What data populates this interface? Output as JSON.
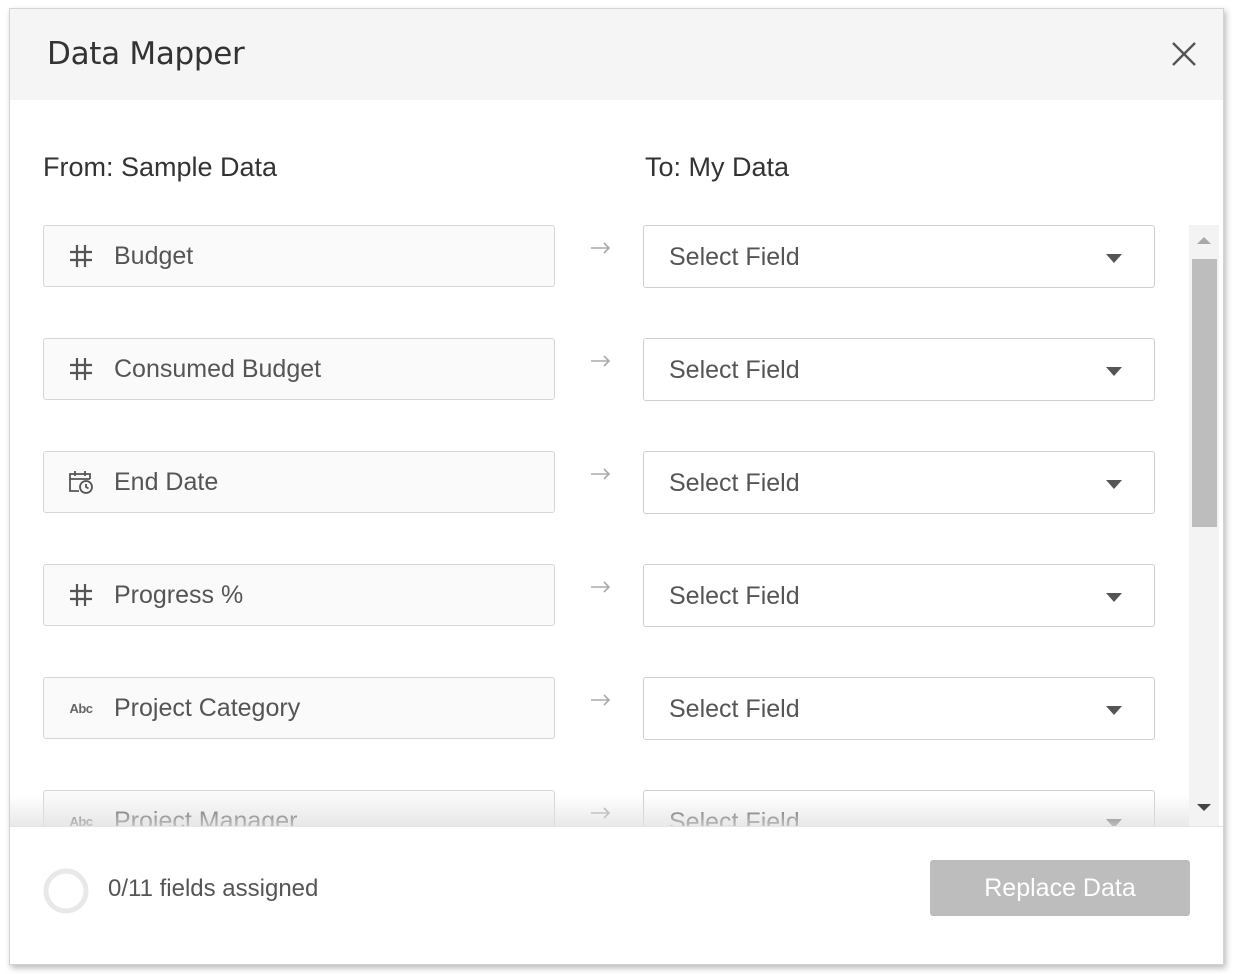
{
  "dialog": {
    "title": "Data Mapper",
    "close_icon": "close-icon"
  },
  "columns": {
    "from_label": "From: Sample Data",
    "to_label": "To: My Data"
  },
  "mappings": [
    {
      "source": "Budget",
      "type_icon": "number-icon",
      "type_glyph": "#",
      "target": "Select Field"
    },
    {
      "source": "Consumed Budget",
      "type_icon": "number-icon",
      "type_glyph": "#",
      "target": "Select Field"
    },
    {
      "source": "End Date",
      "type_icon": "date-icon",
      "type_glyph": "",
      "target": "Select Field"
    },
    {
      "source": "Progress %",
      "type_icon": "number-icon",
      "type_glyph": "#",
      "target": "Select Field"
    },
    {
      "source": "Project Category",
      "type_icon": "string-icon",
      "type_glyph": "Abc",
      "target": "Select Field"
    },
    {
      "source": "Project Manager",
      "type_icon": "string-icon",
      "type_glyph": "Abc",
      "target": "Select Field"
    }
  ],
  "footer": {
    "assigned_count": 0,
    "total_fields": 11,
    "assigned_text": "0/11 fields assigned",
    "replace_button_label": "Replace Data",
    "replace_button_enabled": false
  },
  "colors": {
    "header_bg": "#f5f5f5",
    "button_disabled_bg": "#bdbdbd",
    "text": "#555555",
    "ring": "#e8e8e8"
  }
}
